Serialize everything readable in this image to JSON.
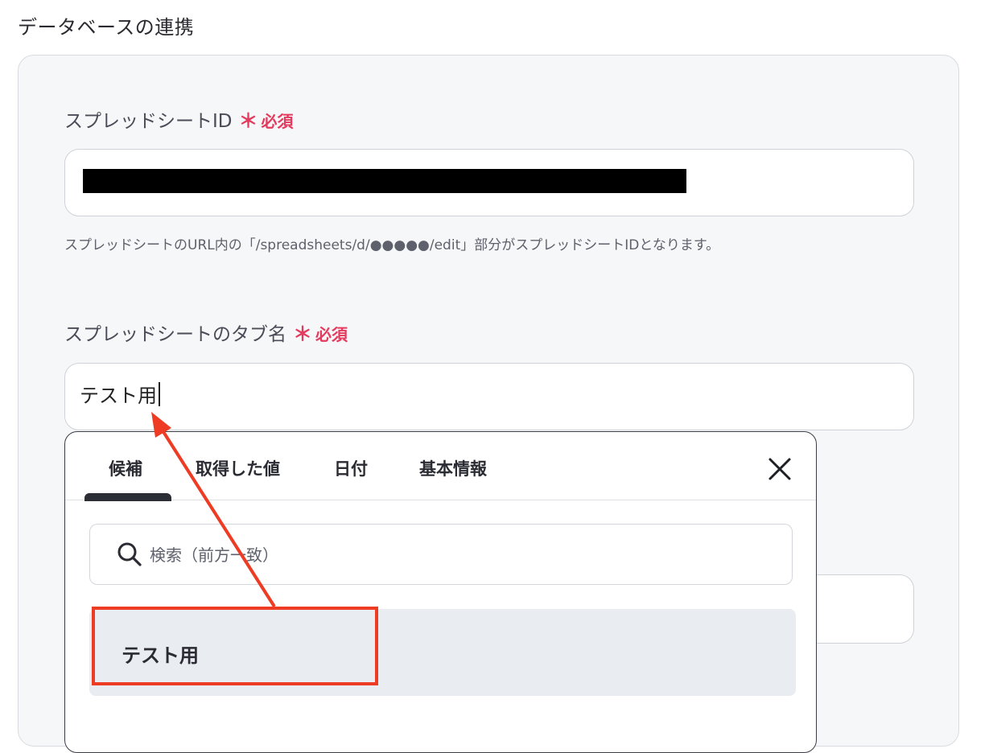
{
  "section_title": "データベースの連携",
  "spreadsheet_id": {
    "label": "スプレッドシートID",
    "required_mark": "＊",
    "required_text": "必須",
    "help_text": "スプレッドシートのURL内の「/spreadsheets/d/●●●●●/edit」部分がスプレッドシートIDとなります。"
  },
  "tab_name": {
    "label": "スプレッドシートのタブ名",
    "required_mark": "＊",
    "required_text": "必須",
    "value": "テスト用"
  },
  "dropdown": {
    "tabs": [
      {
        "label": "候補"
      },
      {
        "label": "取得した値"
      },
      {
        "label": "日付"
      },
      {
        "label": "基本情報"
      }
    ],
    "search_placeholder": "検索（前方一致）",
    "options": [
      {
        "label": "テスト用"
      }
    ]
  },
  "colors": {
    "required": "#e33a5d",
    "annotation": "#ee3b24",
    "panel_bg": "#f6f7f9"
  }
}
